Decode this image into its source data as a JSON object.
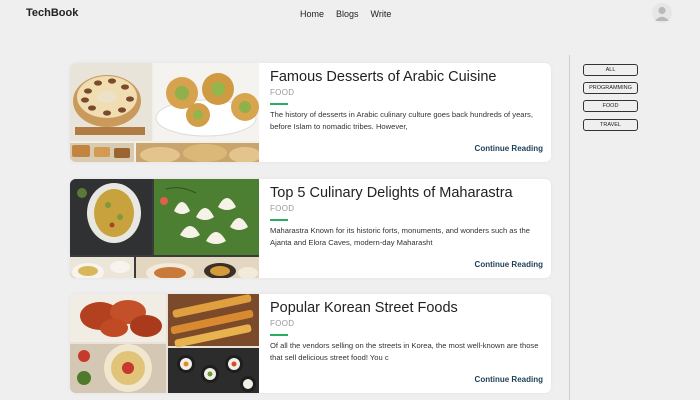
{
  "nav": {
    "brand": "TechBook",
    "links": [
      "Home",
      "Blogs",
      "Write"
    ],
    "avatar_icon": "user-avatar-icon"
  },
  "categories": [
    "ALL",
    "PROGRAMMING",
    "FOOD",
    "TRAVEL"
  ],
  "posts": [
    {
      "title": "Famous Desserts of Arabic Cuisine",
      "category": "FOOD",
      "excerpt": "The history of desserts in Arabic culinary culture goes back hundreds of years, before Islam to nomadic tribes. However,",
      "cta": "Continue Reading"
    },
    {
      "title": "Top 5 Culinary Delights of Maharastra",
      "category": "FOOD",
      "excerpt": "Maharastra Known for its historic forts, monuments, and wonders such as the Ajanta and Elora Caves, modern-day Maharasht",
      "cta": "Continue Reading"
    },
    {
      "title": "Popular Korean Street Foods",
      "category": "FOOD",
      "excerpt": "Of all the vendors selling on the streets in Korea, the most well-known are those that sell delicious street food! You c",
      "cta": "Continue Reading"
    }
  ],
  "colors": {
    "accent": "#27ae60",
    "link": "#1d3f57",
    "background": "#efefef"
  }
}
